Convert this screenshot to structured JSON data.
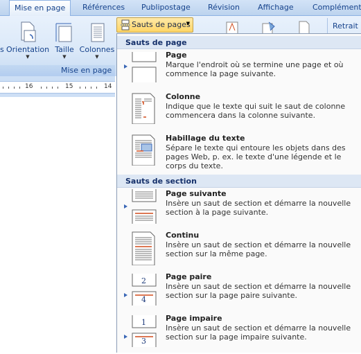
{
  "tabs": [
    "Mise en page",
    "Références",
    "Publipostage",
    "Révision",
    "Affichage",
    "Compléments"
  ],
  "ribbon": {
    "cut_label": "s",
    "orientation": "Orientation",
    "taille": "Taille",
    "colonnes": "Colonnes",
    "sauts_button": "Sauts de pages",
    "retrait": "Retrait",
    "group_label": "Mise en page"
  },
  "ruler": [
    "16",
    "15",
    "14"
  ],
  "menu": {
    "page_breaks_header": "Sauts de page",
    "section_breaks_header": "Sauts de section",
    "items": [
      {
        "title": "Page",
        "desc": "Marque l'endroit où se termine une page et où commence la page suivante."
      },
      {
        "title": "Colonne",
        "desc": "Indique que le texte qui suit le saut de colonne commencera dans la colonne suivante."
      },
      {
        "title": "Habillage du texte",
        "desc": "Sépare le texte qui entoure les objets dans des pages Web, p. ex. le texte d'une légende et le corps du texte."
      },
      {
        "title": "Page suivante",
        "desc": "Insère un saut de section et démarre la nouvelle section à la page suivante."
      },
      {
        "title": "Continu",
        "desc": "Insère un saut de section et démarre la nouvelle section sur la même page."
      },
      {
        "title": "Page paire",
        "desc": "Insère un saut de section et démarre la nouvelle section sur la page paire suivante."
      },
      {
        "title": "Page impaire",
        "desc": "Insère un saut de section et démarre la nouvelle section sur la page impaire suivante."
      }
    ]
  },
  "icons": {
    "dropdown": "chevron-down-icon",
    "page_break": "page-break-icon",
    "column_break": "column-break-icon",
    "text_wrap": "text-wrapping-icon",
    "next_page": "next-page-icon",
    "continuous": "continuous-icon",
    "even_page": "even-page-icon",
    "odd_page": "odd-page-icon"
  },
  "colors": {
    "accent": "#15428b",
    "highlight": "#ffd666",
    "break_line": "#d04a1a"
  }
}
